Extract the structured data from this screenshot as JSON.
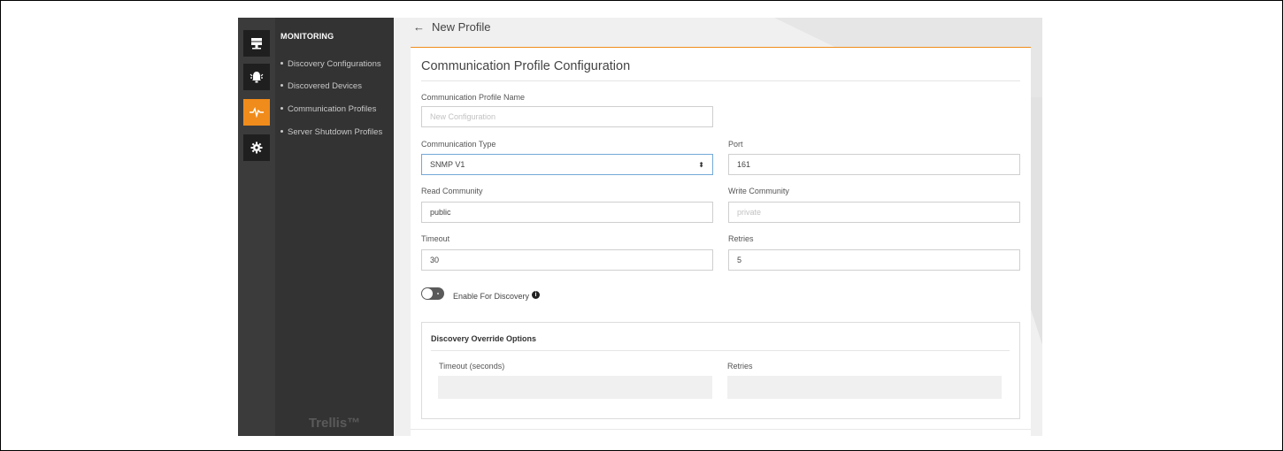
{
  "header": {
    "back_arrow": "←",
    "title": "New Profile"
  },
  "rail": {
    "items": [
      {
        "icon": "server-icon",
        "active": false
      },
      {
        "icon": "alarm-icon",
        "active": false
      },
      {
        "icon": "pulse-icon",
        "active": true
      },
      {
        "icon": "gear-icon",
        "active": false
      }
    ]
  },
  "sidebar": {
    "section_title": "MONITORING",
    "items": [
      {
        "label": "Discovery Configurations"
      },
      {
        "label": "Discovered Devices"
      },
      {
        "label": "Communication Profiles"
      },
      {
        "label": "Server Shutdown Profiles"
      }
    ],
    "brand": "Trellis™"
  },
  "form": {
    "title": "Communication Profile Configuration",
    "profile_name": {
      "label": "Communication Profile Name",
      "placeholder": "New Configuration",
      "value": ""
    },
    "communication_type": {
      "label": "Communication Type",
      "value": "SNMP V1",
      "caret": "⬍"
    },
    "port": {
      "label": "Port",
      "value": "161"
    },
    "read_community": {
      "label": "Read Community",
      "value": "public"
    },
    "write_community": {
      "label": "Write Community",
      "placeholder": "private",
      "value": ""
    },
    "timeout": {
      "label": "Timeout",
      "value": "30"
    },
    "retries": {
      "label": "Retries",
      "value": "5"
    },
    "discovery_toggle": {
      "label": "Enable For Discovery",
      "enabled": false,
      "info_glyph": "i"
    },
    "override": {
      "title": "Discovery Override Options",
      "timeout_label": "Timeout (seconds)",
      "retries_label": "Retries"
    }
  },
  "colors": {
    "accent": "#f08c1b",
    "rail": "#3b3b3b",
    "sidebar": "#333333"
  }
}
